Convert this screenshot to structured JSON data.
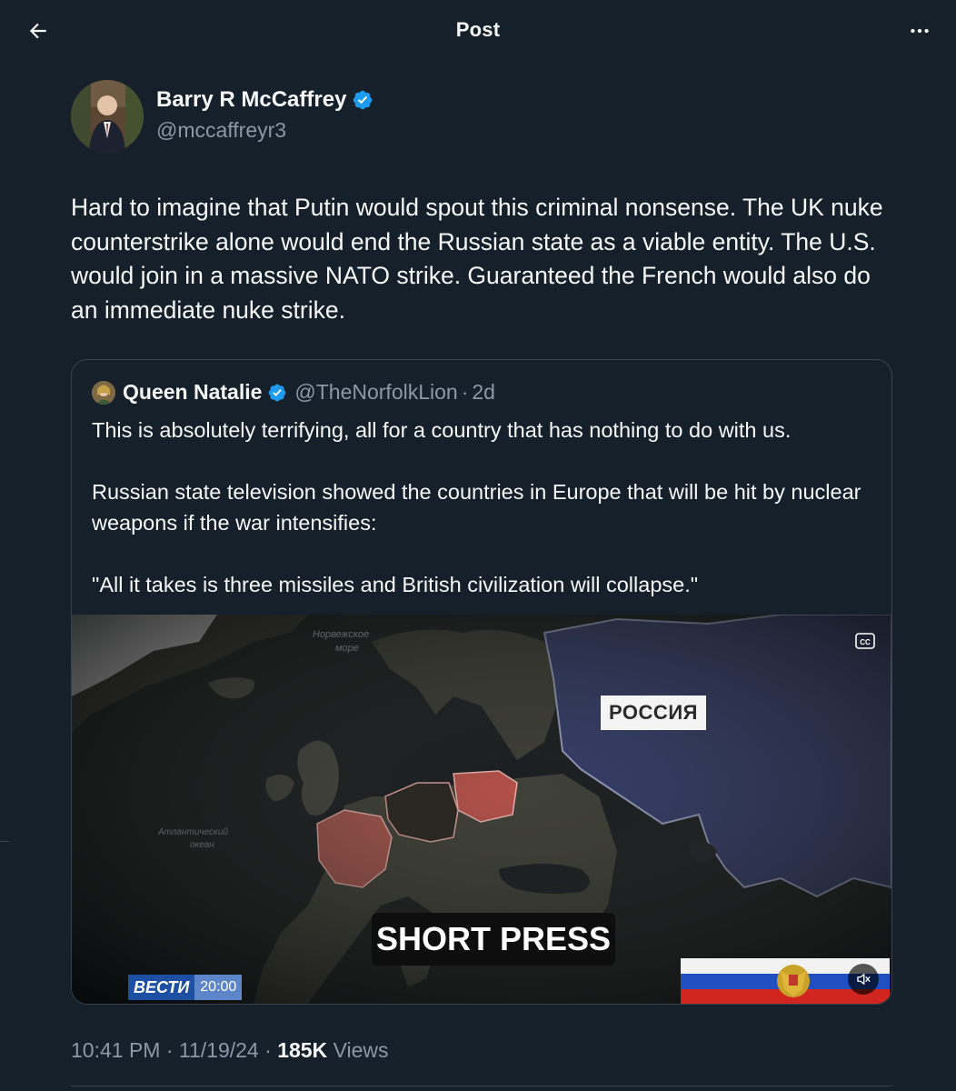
{
  "header": {
    "title": "Post",
    "back_icon": "arrow-left-icon",
    "more_icon": "ellipsis-icon"
  },
  "author": {
    "name": "Barry R McCaffrey",
    "handle": "@mccaffreyr3",
    "verified": true
  },
  "tweet": {
    "text": "Hard to imagine that Putin would spout this criminal nonsense. The UK nuke counterstrike alone would end the Russian state as a viable entity. The U.S. would join in a massive NATO strike. Guaranteed the French would also do an immediate nuke strike."
  },
  "quote": {
    "name": "Queen Natalie",
    "handle": "@TheNorfolkLion",
    "separator": "·",
    "time": "2d",
    "paragraphs": [
      "This is absolutely terrifying, all for a country that has nothing to do with us.",
      "Russian state television showed the countries in Europe that will be hit by nuclear weapons if the war intensifies:",
      "\"All it takes is three missiles and British civilization will collapse.\""
    ],
    "media": {
      "russia_label": "РОССИЯ",
      "caption": "SHORT PRESS",
      "channel": "ВЕСТИ",
      "channel_time": "20:00",
      "sea_label_1": "Норвежское",
      "sea_label_2": "море",
      "ocean_label_1": "Атлантический",
      "ocean_label_2": "океан"
    }
  },
  "meta": {
    "time": "10:41 PM",
    "date": "11/19/24",
    "separator": "·",
    "views_count": "185K",
    "views_label": "Views"
  },
  "colors": {
    "background": "#15202b",
    "verified": "#1d9bf0",
    "secondary_text": "#8b98a5",
    "border": "#38444d"
  }
}
